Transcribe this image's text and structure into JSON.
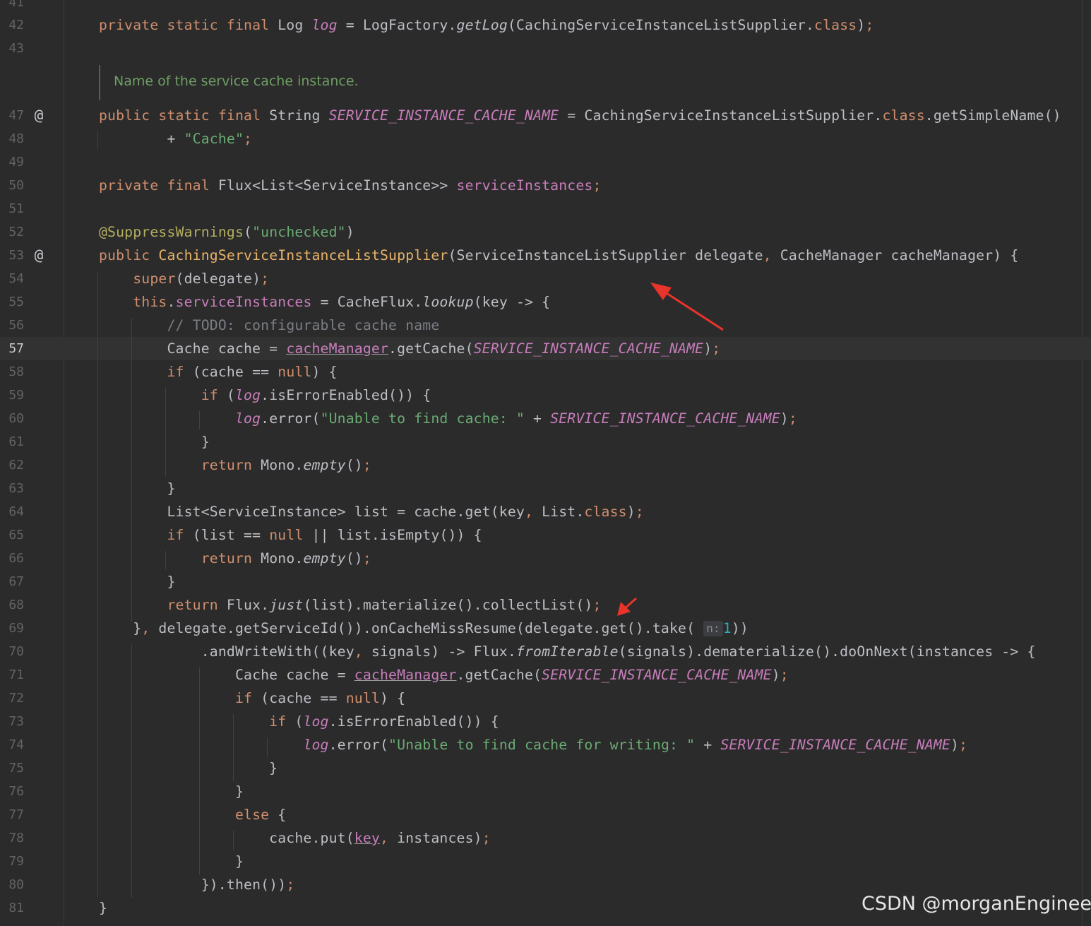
{
  "editor": {
    "partial_top_line_number": "41",
    "doc_comment": "Name of the service cache instance.",
    "inlay_hint_param": "n:",
    "current_line_number": "57",
    "gutter_icons": [
      "at-icon",
      "at-icon"
    ],
    "lines": [
      {
        "n": "42",
        "tokens": [
          {
            "t": "private static final ",
            "c": "kw"
          },
          {
            "t": "Log "
          },
          {
            "t": "log",
            "c": "cst"
          },
          {
            "t": " = LogFactory."
          },
          {
            "t": "getLog",
            "c": "sfn"
          },
          {
            "t": "(CachingServiceInstanceListSupplier."
          },
          {
            "t": "class",
            "c": "kw"
          },
          {
            "t": ")"
          },
          {
            "t": ";",
            "c": "kw"
          }
        ]
      },
      {
        "n": "43",
        "tokens": []
      },
      {
        "n": "47",
        "tokens": [
          {
            "t": "public static final ",
            "c": "kw"
          },
          {
            "t": "String "
          },
          {
            "t": "SERVICE_INSTANCE_CACHE_NAME",
            "c": "cst"
          },
          {
            "t": " = CachingServiceInstanceListSupplier."
          },
          {
            "t": "class",
            "c": "kw"
          },
          {
            "t": ".getSimpleName()"
          }
        ]
      },
      {
        "n": "48",
        "tokens": [
          {
            "t": "        + "
          },
          {
            "t": "\"Cache\"",
            "c": "str"
          },
          {
            "t": ";",
            "c": "kw"
          }
        ]
      },
      {
        "n": "49",
        "tokens": []
      },
      {
        "n": "50",
        "tokens": [
          {
            "t": "private final ",
            "c": "kw"
          },
          {
            "t": "Flux<List<ServiceInstance>> "
          },
          {
            "t": "serviceInstances",
            "c": "fld"
          },
          {
            "t": ";",
            "c": "kw"
          }
        ]
      },
      {
        "n": "51",
        "tokens": []
      },
      {
        "n": "52",
        "tokens": [
          {
            "t": "@SuppressWarnings",
            "c": "ann"
          },
          {
            "t": "("
          },
          {
            "t": "\"unchecked\"",
            "c": "str"
          },
          {
            "t": ")"
          }
        ]
      },
      {
        "n": "53",
        "tokens": [
          {
            "t": "public ",
            "c": "kw"
          },
          {
            "t": "CachingServiceInstanceListSupplier",
            "c": "fn"
          },
          {
            "t": "(ServiceInstanceListSupplier delegate"
          },
          {
            "t": ", ",
            "c": "kw"
          },
          {
            "t": "CacheManager cacheManager) {"
          }
        ]
      },
      {
        "n": "54",
        "tokens": [
          {
            "t": "    "
          },
          {
            "t": "super",
            "c": "kw"
          },
          {
            "t": "(delegate)"
          },
          {
            "t": ";",
            "c": "kw"
          }
        ]
      },
      {
        "n": "55",
        "tokens": [
          {
            "t": "    "
          },
          {
            "t": "this",
            "c": "kw"
          },
          {
            "t": "."
          },
          {
            "t": "serviceInstances",
            "c": "fld"
          },
          {
            "t": " = CacheFlux."
          },
          {
            "t": "lookup",
            "c": "sfn"
          },
          {
            "t": "(key -> {"
          }
        ]
      },
      {
        "n": "56",
        "tokens": [
          {
            "t": "        "
          },
          {
            "t": "// TODO: configurable cache name",
            "c": "cmt"
          }
        ]
      },
      {
        "n": "57",
        "tokens": [
          {
            "t": "        Cache cache = "
          },
          {
            "t": "cacheManager",
            "c": "ul"
          },
          {
            "t": ".getCache("
          },
          {
            "t": "SERVICE_INSTANCE_CACHE_NAME",
            "c": "cst"
          },
          {
            "t": ")"
          },
          {
            "t": ";",
            "c": "kw"
          }
        ]
      },
      {
        "n": "58",
        "tokens": [
          {
            "t": "        "
          },
          {
            "t": "if",
            "c": "kw"
          },
          {
            "t": " (cache == "
          },
          {
            "t": "null",
            "c": "kw"
          },
          {
            "t": ") {"
          }
        ]
      },
      {
        "n": "59",
        "tokens": [
          {
            "t": "            "
          },
          {
            "t": "if",
            "c": "kw"
          },
          {
            "t": " ("
          },
          {
            "t": "log",
            "c": "cst"
          },
          {
            "t": ".isErrorEnabled()) {"
          }
        ]
      },
      {
        "n": "60",
        "tokens": [
          {
            "t": "                "
          },
          {
            "t": "log",
            "c": "cst"
          },
          {
            "t": ".error("
          },
          {
            "t": "\"Unable to find cache: \"",
            "c": "str"
          },
          {
            "t": " + "
          },
          {
            "t": "SERVICE_INSTANCE_CACHE_NAME",
            "c": "cst"
          },
          {
            "t": ")"
          },
          {
            "t": ";",
            "c": "kw"
          }
        ]
      },
      {
        "n": "61",
        "tokens": [
          {
            "t": "            }"
          }
        ]
      },
      {
        "n": "62",
        "tokens": [
          {
            "t": "            "
          },
          {
            "t": "return ",
            "c": "kw"
          },
          {
            "t": "Mono."
          },
          {
            "t": "empty",
            "c": "sfn"
          },
          {
            "t": "()"
          },
          {
            "t": ";",
            "c": "kw"
          }
        ]
      },
      {
        "n": "63",
        "tokens": [
          {
            "t": "        }"
          }
        ]
      },
      {
        "n": "64",
        "tokens": [
          {
            "t": "        List<ServiceInstance> list = cache.get(key"
          },
          {
            "t": ", ",
            "c": "kw"
          },
          {
            "t": "List."
          },
          {
            "t": "class",
            "c": "kw"
          },
          {
            "t": ")"
          },
          {
            "t": ";",
            "c": "kw"
          }
        ]
      },
      {
        "n": "65",
        "tokens": [
          {
            "t": "        "
          },
          {
            "t": "if",
            "c": "kw"
          },
          {
            "t": " (list == "
          },
          {
            "t": "null",
            "c": "kw"
          },
          {
            "t": " || list.isEmpty()) {"
          }
        ]
      },
      {
        "n": "66",
        "tokens": [
          {
            "t": "            "
          },
          {
            "t": "return ",
            "c": "kw"
          },
          {
            "t": "Mono."
          },
          {
            "t": "empty",
            "c": "sfn"
          },
          {
            "t": "()"
          },
          {
            "t": ";",
            "c": "kw"
          }
        ]
      },
      {
        "n": "67",
        "tokens": [
          {
            "t": "        }"
          }
        ]
      },
      {
        "n": "68",
        "tokens": [
          {
            "t": "        "
          },
          {
            "t": "return ",
            "c": "kw"
          },
          {
            "t": "Flux."
          },
          {
            "t": "just",
            "c": "sfn"
          },
          {
            "t": "(list).materialize().collectList()"
          },
          {
            "t": ";",
            "c": "kw"
          }
        ]
      },
      {
        "n": "69",
        "tokens": [
          {
            "t": "    }"
          },
          {
            "t": ", ",
            "c": "kw"
          },
          {
            "t": "delegate.getServiceId()).onCacheMissResume(delegate.get().take( "
          },
          {
            "t": "n:",
            "c": "hint"
          },
          {
            "t": "1",
            "c": "num"
          },
          {
            "t": "))"
          }
        ]
      },
      {
        "n": "70",
        "tokens": [
          {
            "t": "            .andWriteWith((key"
          },
          {
            "t": ", ",
            "c": "kw"
          },
          {
            "t": "signals) -> Flux."
          },
          {
            "t": "fromIterable",
            "c": "sfn"
          },
          {
            "t": "(signals).dematerialize().doOnNext(instances -> {"
          }
        ]
      },
      {
        "n": "71",
        "tokens": [
          {
            "t": "                Cache cache = "
          },
          {
            "t": "cacheManager",
            "c": "ul"
          },
          {
            "t": ".getCache("
          },
          {
            "t": "SERVICE_INSTANCE_CACHE_NAME",
            "c": "cst"
          },
          {
            "t": ")"
          },
          {
            "t": ";",
            "c": "kw"
          }
        ]
      },
      {
        "n": "72",
        "tokens": [
          {
            "t": "                "
          },
          {
            "t": "if",
            "c": "kw"
          },
          {
            "t": " (cache == "
          },
          {
            "t": "null",
            "c": "kw"
          },
          {
            "t": ") {"
          }
        ]
      },
      {
        "n": "73",
        "tokens": [
          {
            "t": "                    "
          },
          {
            "t": "if",
            "c": "kw"
          },
          {
            "t": " ("
          },
          {
            "t": "log",
            "c": "cst"
          },
          {
            "t": ".isErrorEnabled()) {"
          }
        ]
      },
      {
        "n": "74",
        "tokens": [
          {
            "t": "                        "
          },
          {
            "t": "log",
            "c": "cst"
          },
          {
            "t": ".error("
          },
          {
            "t": "\"Unable to find cache for writing: \"",
            "c": "str"
          },
          {
            "t": " + "
          },
          {
            "t": "SERVICE_INSTANCE_CACHE_NAME",
            "c": "cst"
          },
          {
            "t": ")"
          },
          {
            "t": ";",
            "c": "kw"
          }
        ]
      },
      {
        "n": "75",
        "tokens": [
          {
            "t": "                    }"
          }
        ]
      },
      {
        "n": "76",
        "tokens": [
          {
            "t": "                }"
          }
        ]
      },
      {
        "n": "77",
        "tokens": [
          {
            "t": "                "
          },
          {
            "t": "else",
            "c": "kw"
          },
          {
            "t": " {"
          }
        ]
      },
      {
        "n": "78",
        "tokens": [
          {
            "t": "                    cache.put("
          },
          {
            "t": "key",
            "c": "ul"
          },
          {
            "t": ", ",
            "c": "kw"
          },
          {
            "t": "instances)"
          },
          {
            "t": ";",
            "c": "kw"
          }
        ]
      },
      {
        "n": "79",
        "tokens": [
          {
            "t": "                }"
          }
        ]
      },
      {
        "n": "80",
        "tokens": [
          {
            "t": "            }).then())"
          },
          {
            "t": ";",
            "c": "kw"
          }
        ]
      },
      {
        "n": "81",
        "tokens": [
          {
            "t": "}"
          }
        ]
      }
    ]
  },
  "watermark": "CSDN @morganEngineer",
  "colors": {
    "background": "#2b2b2b",
    "keyword": "#cf8e6d",
    "field": "#c77dbb",
    "string": "#6aab73",
    "comment": "#7a7e85",
    "annotation": "#b3ae60",
    "method_declaration": "#e8b36a",
    "number": "#2aacb8",
    "arrow": "#e8342a"
  }
}
